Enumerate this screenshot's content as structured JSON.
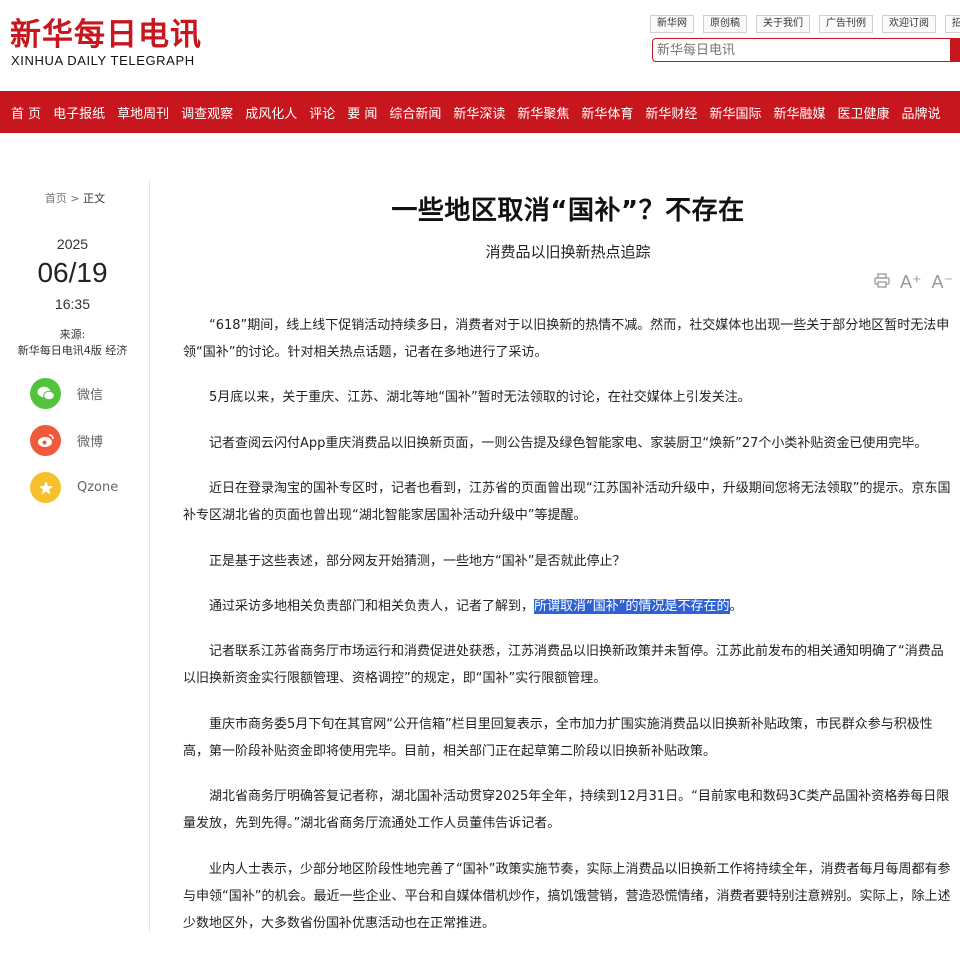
{
  "header": {
    "logo_cn": "新华每日电讯",
    "logo_en": "XINHUA DAILY TELEGRAPH",
    "top_links": [
      "新华网",
      "原创稿",
      "关于我们",
      "广告刊例",
      "欢迎订阅",
      "招聘"
    ],
    "search_placeholder": "新华每日电讯"
  },
  "nav": [
    "首 页",
    "电子报纸",
    "草地周刊",
    "调查观察",
    "成风化人",
    "评论",
    "要 闻",
    "综合新闻",
    "新华深读",
    "新华聚焦",
    "新华体育",
    "新华财经",
    "新华国际",
    "新华融媒",
    "医卫健康",
    "品牌说"
  ],
  "sidebar": {
    "breadcrumb_home": "首页",
    "breadcrumb_sep": ">",
    "breadcrumb_current": "正文",
    "year": "2025",
    "month_day": "06/19",
    "time": "16:35",
    "source_label": "来源:",
    "source_value": "新华每日电讯4版 经济",
    "share": [
      {
        "name": "微信",
        "icon": "wechat-icon",
        "color": "#53c33c"
      },
      {
        "name": "微博",
        "icon": "weibo-icon",
        "color": "#ef5a3a"
      },
      {
        "name": "Qzone",
        "icon": "qzone-icon",
        "color": "#f7c12e"
      }
    ]
  },
  "article": {
    "title": "一些地区取消“国补”？不存在",
    "subtitle": "消费品以旧换新热点追踪",
    "p1": "“618”期间，线上线下促销活动持续多日，消费者对于以旧换新的热情不减。然而，社交媒体也出现一些关于部分地区暂时无法申领“国补”的讨论。针对相关热点话题，记者在多地进行了采访。",
    "p2": "5月底以来，关于重庆、江苏、湖北等地“国补”暂时无法领取的讨论，在社交媒体上引发关注。",
    "p3": "记者查阅云闪付App重庆消费品以旧换新页面，一则公告提及绿色智能家电、家装厨卫“焕新”27个小类补贴资金已使用完毕。",
    "p4": "近日在登录淘宝的国补专区时，记者也看到，江苏省的页面曾出现“江苏国补活动升级中，升级期间您将无法领取”的提示。京东国补专区湖北省的页面也曾出现“湖北智能家居国补活动升级中”等提醒。",
    "p5": "正是基于这些表述，部分网友开始猜测，一些地方“国补”是否就此停止？",
    "p6_pre": "通过采访多地相关负责部门和相关负责人，记者了解到，",
    "p6_highlight": "所谓取消“国补”的情况是不存在的",
    "p6_post": "。",
    "p7": "记者联系江苏省商务厅市场运行和消费促进处获悉，江苏消费品以旧换新政策并未暂停。江苏此前发布的相关通知明确了“消费品以旧换新资金实行限额管理、资格调控”的规定，即“国补”实行限额管理。",
    "p8": "重庆市商务委5月下旬在其官网“公开信箱”栏目里回复表示，全市加力扩围实施消费品以旧换新补贴政策，市民群众参与积极性高，第一阶段补贴资金即将使用完毕。目前，相关部门正在起草第二阶段以旧换新补贴政策。",
    "p9": "湖北省商务厅明确答复记者称，湖北国补活动贯穿2025年全年，持续到12月31日。“目前家电和数码3C类产品国补资格券每日限量发放，先到先得。”湖北省商务厅流通处工作人员董伟告诉记者。",
    "p10": "业内人士表示，少部分地区阶段性地完善了“国补”政策实施节奏，实际上消费品以旧换新工作将持续全年，消费者每月每周都有参与申领“国补”的机会。最近一些企业、平台和自媒体借机炒作，搞饥饿营销，营造恐慌情绪，消费者要特别注意辨别。实际上，除上述少数地区外，大多数省份国补优惠活动也在正常推进。"
  },
  "tools": {
    "print_icon": "print-icon",
    "font_up": "A⁺",
    "font_down": "A⁻"
  },
  "colors": {
    "brand_red": "#c8161e",
    "highlight": "#2f61d2"
  }
}
